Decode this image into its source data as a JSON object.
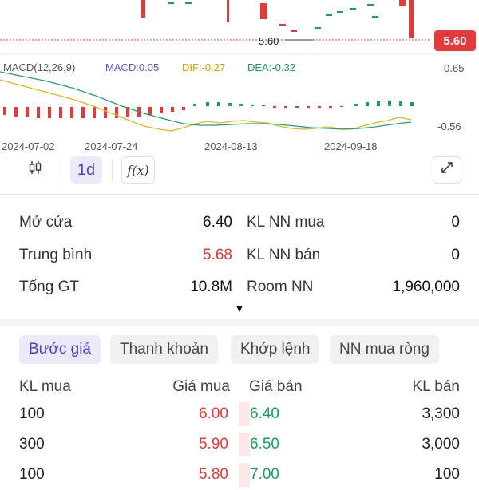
{
  "chart": {
    "current_price_label": "5.60",
    "last_low_label": "5.60",
    "macd_legend": {
      "title": "MACD(12,26,9)",
      "macd": "MACD:0.05",
      "dif": "DIF:-0.27",
      "dea": "DEA:-0.32"
    },
    "macd_axis_top": "0.65",
    "macd_axis_bottom": "-0.56",
    "dates": [
      "2024-07-02",
      "2024-07-24",
      "2024-08-13",
      "2024-09-18"
    ],
    "colors": {
      "up": "#16a05a",
      "down": "#e23b3b",
      "dif": "#e6b422",
      "dea": "#2a9d6e",
      "macd_title": "#555555",
      "macd_label": "#5a55c9"
    }
  },
  "toolbar": {
    "candle_icon": "candlestick-icon",
    "timeframe": "1d",
    "fx_label": "f(x)",
    "expand_icon": "expand-icon"
  },
  "stats": {
    "open_label": "Mở cửa",
    "open_value": "6.40",
    "avg_label": "Trung bình",
    "avg_value": "5.68",
    "total_label": "Tổng GT",
    "total_value": "10.8M",
    "nn_buy_label": "KL NN mua",
    "nn_buy_value": "0",
    "nn_sell_label": "KL NN bán",
    "nn_sell_value": "0",
    "room_label": "Room NN",
    "room_value": "1,960,000"
  },
  "tabs": [
    "Bước giá",
    "Thanh khoản",
    "Khớp lệnh",
    "NN mua ròng"
  ],
  "orderbook": {
    "headers": {
      "buy_vol": "KL mua",
      "buy_price": "Giá mua",
      "sell_price": "Giá bán",
      "sell_vol": "KL bán"
    },
    "rows": [
      {
        "buy_vol": "100",
        "buy_price": "6.00",
        "sell_price": "6.40",
        "sell_vol": "3,300"
      },
      {
        "buy_vol": "300",
        "buy_price": "5.90",
        "sell_price": "6.50",
        "sell_vol": "3,000"
      },
      {
        "buy_vol": "100",
        "buy_price": "5.80",
        "sell_price": "7.00",
        "sell_vol": "100"
      }
    ]
  }
}
